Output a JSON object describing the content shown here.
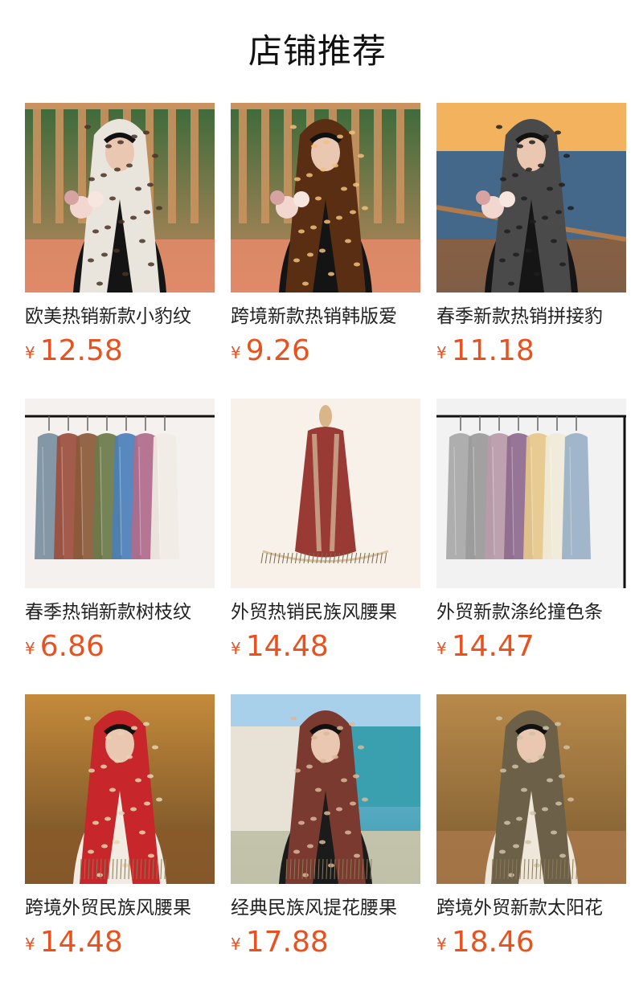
{
  "page_title": "店铺推荐",
  "products": [
    {
      "name": "欧美热销新款小豹纹",
      "currency": "¥",
      "price": "12.58",
      "image_icon": "leopard-hijab-photo",
      "colors": {
        "bg1": "#3c6a3a",
        "bg2": "#c08a5e",
        "scarf": "#e9e4dc",
        "spot": "#4a3426",
        "body": "#141414",
        "floor": "#e58a6a"
      }
    },
    {
      "name": "跨境新款热销韩版爱",
      "currency": "¥",
      "price": "9.26",
      "image_icon": "floral-hijab-photo",
      "colors": {
        "bg1": "#3c6a3a",
        "bg2": "#c08a5e",
        "scarf": "#5a2e12",
        "spot": "#f0c07a",
        "body": "#141414",
        "floor": "#e58a6a"
      }
    },
    {
      "name": "春季新款热销拼接豹",
      "currency": "¥",
      "price": "11.18",
      "image_icon": "seaside-hijab-photo",
      "colors": {
        "bg1": "#f2b15b",
        "bg2": "#4a6f8e",
        "scarf": "#4a4a4a",
        "spot": "#1f1f1f",
        "body": "#151515",
        "floor": "#8a5a3a"
      }
    },
    {
      "name": "春季热销新款树枝纹",
      "currency": "¥",
      "price": "6.86",
      "image_icon": "scarf-rack-photo",
      "colors": {
        "bg1": "#f4f1ee",
        "bg2": "#f4f1ee",
        "scarf": "#7a8fa0",
        "spot": "#9b4e3e",
        "body": "#4a7fb8",
        "floor": "#f4f1ee"
      }
    },
    {
      "name": "外贸热销民族风腰果",
      "currency": "¥",
      "price": "14.48",
      "image_icon": "mannequin-scarf-photo",
      "colors": {
        "bg1": "#f7f1ea",
        "bg2": "#f7f1ea",
        "scarf": "#9a3a34",
        "spot": "#d8c2a0",
        "body": "#d9b58a",
        "floor": "#f7f1ea"
      }
    },
    {
      "name": "外贸新款涤纶撞色条",
      "currency": "¥",
      "price": "14.47",
      "image_icon": "striped-scarf-rack-photo",
      "colors": {
        "bg1": "#f2f2f2",
        "bg2": "#f2f2f2",
        "scarf": "#a8a8a8",
        "spot": "#e6c88a",
        "body": "#8e6a8e",
        "floor": "#f2f2f2"
      }
    },
    {
      "name": "跨境外贸民族风腰果",
      "currency": "¥",
      "price": "14.48",
      "image_icon": "red-paisley-scarf-photo",
      "colors": {
        "bg1": "#c48a3a",
        "bg2": "#6b4a26",
        "scarf": "#c7262a",
        "spot": "#e8d3b0",
        "body": "#f1ebe2",
        "floor": "#8a5a2a"
      }
    },
    {
      "name": "经典民族风提花腰果",
      "currency": "¥",
      "price": "17.88",
      "image_icon": "beach-paisley-scarf-photo",
      "colors": {
        "bg1": "#7fb6d8",
        "bg2": "#3aa0b0",
        "scarf": "#7a3a30",
        "spot": "#d9b99a",
        "body": "#1b1b1b",
        "floor": "#d8c7a8"
      }
    },
    {
      "name": "跨境外贸新款太阳花",
      "currency": "¥",
      "price": "18.46",
      "image_icon": "autumn-paisley-scarf-photo",
      "colors": {
        "bg1": "#b88a4a",
        "bg2": "#7a5a30",
        "scarf": "#6d6048",
        "spot": "#cfc2a6",
        "body": "#efe7da",
        "floor": "#a8784a"
      }
    }
  ]
}
